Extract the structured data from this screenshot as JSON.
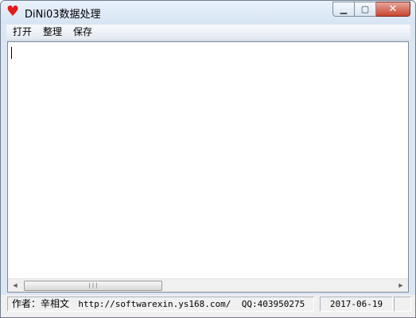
{
  "window": {
    "title": "DiNi03数据处理",
    "icon": "heart-icon",
    "controls": {
      "minimize": "minimize-icon",
      "maximize": "maximize-icon",
      "close": "close-icon"
    }
  },
  "menu": {
    "items": [
      {
        "label": "打开"
      },
      {
        "label": "整理"
      },
      {
        "label": "保存"
      }
    ]
  },
  "editor": {
    "content": ""
  },
  "status": {
    "author": "作者：辛相文",
    "url": "http://softwarexin.ys168.com/",
    "qq": "QQ:403950275",
    "date": "2017-06-19"
  },
  "colors": {
    "icon_red": "#e21b1b",
    "close_red": "#c8462f"
  }
}
